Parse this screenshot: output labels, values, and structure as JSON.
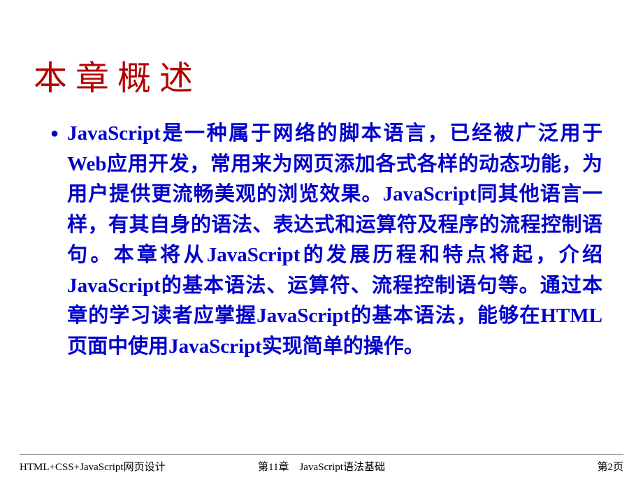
{
  "title": "本章概述",
  "content": {
    "paragraph": "JavaScript是一种属于网络的脚本语言，已经被广泛用于Web应用开发，常用来为网页添加各式各样的动态功能，为用户提供更流畅美观的浏览效果。JavaScript同其他语言一样，有其自身的语法、表达式和运算符及程序的流程控制语句。本章将从JavaScript的发展历程和特点将起，介绍JavaScript的基本语法、运算符、流程控制语句等。通过本章的学习读者应掌握JavaScript的基本语法，能够在HTML页面中使用JavaScript实现简单的操作。"
  },
  "footer": {
    "left": "HTML+CSS+JavaScript网页设计",
    "center": "第11章　JavaScript语法基础",
    "right": "第2页"
  }
}
